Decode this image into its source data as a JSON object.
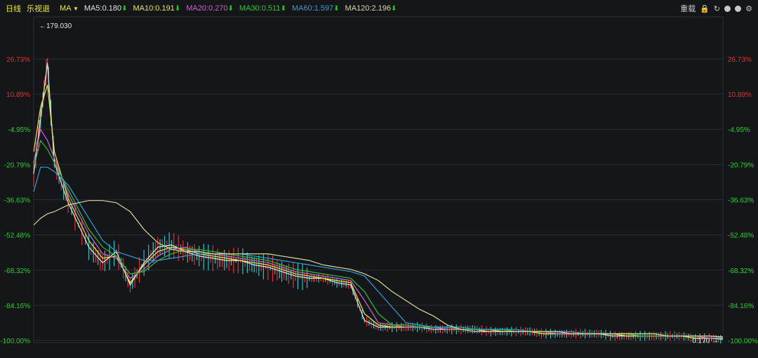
{
  "header": {
    "period": "日线",
    "stock_name": "乐视退",
    "indicator": "MA",
    "ma_items": [
      {
        "label": "MA5:0.180",
        "color": "#e6e6e6"
      },
      {
        "label": "MA10:0.191",
        "color": "#e8e840"
      },
      {
        "label": "MA20:0.270",
        "color": "#d060d0"
      },
      {
        "label": "MA30:0.511",
        "color": "#30c030"
      },
      {
        "label": "MA60:1.597",
        "color": "#2aa0d8"
      },
      {
        "label": "MA120:2.196",
        "color": "#d8d890"
      }
    ],
    "ma_arrow": "⬇",
    "tools_label": "重载"
  },
  "colors": {
    "background": "#15161a",
    "grid": "#2a2c31",
    "up": "#e03030",
    "down": "#30c0c0",
    "neg_label": "#22d022",
    "pos_label": "#e03030"
  },
  "chart_data": {
    "type": "line",
    "y_scale": "percent change",
    "ylim": [
      -100,
      40
    ],
    "yticks": [
      "26.73%",
      "10.89%",
      "-4.95%",
      "-20.79%",
      "-36.63%",
      "-52.48%",
      "-68.32%",
      "-84.16%",
      "-100.00%"
    ],
    "ytick_values": [
      26.73,
      10.89,
      -4.95,
      -20.79,
      -36.63,
      -52.48,
      -68.32,
      -84.16,
      -100.0
    ],
    "annotations": [
      {
        "text": "←179.030",
        "x": 0,
        "y": 36
      },
      {
        "text": "0.170 →",
        "x": 100,
        "y": -99.2
      }
    ],
    "x_domain": [
      0,
      100
    ],
    "series": [
      {
        "name": "MA5",
        "color": "#e6e6e6",
        "x": [
          0,
          1,
          2,
          3,
          5,
          8,
          10,
          12,
          14,
          16,
          18,
          20,
          22,
          24,
          26,
          28,
          30,
          32,
          34,
          36,
          38,
          40,
          42,
          44,
          46,
          48,
          50,
          52,
          54,
          56,
          58,
          60,
          62,
          64,
          66,
          68,
          70,
          72,
          74,
          76,
          78,
          80,
          82,
          84,
          86,
          88,
          90,
          92,
          94,
          96,
          98,
          100
        ],
        "y": [
          -25,
          0,
          25,
          -20,
          -38,
          -58,
          -65,
          -60,
          -75,
          -65,
          -58,
          -57,
          -60,
          -62,
          -63,
          -64,
          -64,
          -66,
          -67,
          -69,
          -71,
          -72,
          -72,
          -74,
          -75,
          -91,
          -94,
          -94,
          -94,
          -94,
          -95,
          -95,
          -95,
          -95,
          -96,
          -96,
          -96,
          -96,
          -97,
          -97,
          -97,
          -97,
          -97,
          -98,
          -98,
          -98,
          -98,
          -98,
          -98,
          -99,
          -99,
          -99.5
        ]
      },
      {
        "name": "MA10",
        "color": "#e8e840",
        "x": [
          0,
          1,
          2,
          3,
          5,
          8,
          10,
          12,
          14,
          16,
          18,
          20,
          22,
          24,
          26,
          28,
          30,
          32,
          34,
          36,
          38,
          40,
          42,
          44,
          46,
          48,
          50,
          52,
          54,
          56,
          58,
          60,
          62,
          64,
          66,
          68,
          70,
          72,
          74,
          76,
          78,
          80,
          82,
          84,
          86,
          88,
          90,
          92,
          94,
          96,
          98,
          100
        ],
        "y": [
          -15,
          5,
          15,
          -15,
          -36,
          -55,
          -63,
          -62,
          -74,
          -66,
          -60,
          -58,
          -59,
          -61,
          -62,
          -63,
          -64,
          -65,
          -66,
          -68,
          -70,
          -71,
          -72,
          -73,
          -74,
          -88,
          -93,
          -94,
          -94,
          -94,
          -94,
          -95,
          -95,
          -95,
          -95,
          -96,
          -96,
          -96,
          -97,
          -97,
          -97,
          -97,
          -97,
          -97,
          -98,
          -98,
          -98,
          -98,
          -98,
          -99,
          -99,
          -99.3
        ]
      },
      {
        "name": "MA20",
        "color": "#d060d0",
        "x": [
          0,
          1,
          2,
          3,
          5,
          8,
          10,
          12,
          14,
          16,
          18,
          20,
          22,
          24,
          26,
          28,
          30,
          32,
          34,
          36,
          38,
          40,
          42,
          44,
          46,
          48,
          50,
          52,
          54,
          56,
          58,
          60,
          62,
          64,
          66,
          68,
          70,
          72,
          74,
          76,
          78,
          80,
          82,
          84,
          86,
          88,
          90,
          92,
          94,
          96,
          98,
          100
        ],
        "y": [
          -20,
          -5,
          -10,
          -18,
          -34,
          -52,
          -61,
          -63,
          -72,
          -68,
          -62,
          -59,
          -58,
          -60,
          -61,
          -62,
          -63,
          -64,
          -65,
          -67,
          -69,
          -70,
          -71,
          -72,
          -73,
          -82,
          -92,
          -93,
          -94,
          -94,
          -94,
          -95,
          -95,
          -95,
          -95,
          -95,
          -96,
          -96,
          -96,
          -97,
          -97,
          -97,
          -97,
          -97,
          -97,
          -98,
          -98,
          -98,
          -98,
          -98,
          -99,
          -99.0
        ]
      },
      {
        "name": "MA30",
        "color": "#30c030",
        "x": [
          0,
          1,
          2,
          3,
          5,
          8,
          10,
          12,
          14,
          16,
          18,
          20,
          22,
          24,
          26,
          28,
          30,
          32,
          34,
          36,
          38,
          40,
          42,
          44,
          46,
          48,
          50,
          52,
          54,
          56,
          58,
          60,
          62,
          64,
          66,
          68,
          70,
          72,
          74,
          76,
          78,
          80,
          82,
          84,
          86,
          88,
          90,
          92,
          94,
          96,
          98,
          100
        ],
        "y": [
          -22,
          -10,
          -14,
          -20,
          -32,
          -50,
          -58,
          -62,
          -70,
          -69,
          -64,
          -61,
          -59,
          -59,
          -60,
          -61,
          -62,
          -63,
          -64,
          -66,
          -68,
          -69,
          -70,
          -71,
          -72,
          -78,
          -88,
          -93,
          -93,
          -94,
          -94,
          -94,
          -95,
          -95,
          -95,
          -95,
          -96,
          -96,
          -96,
          -96,
          -97,
          -97,
          -97,
          -97,
          -97,
          -98,
          -98,
          -98,
          -98,
          -98,
          -98,
          -98.8
        ]
      },
      {
        "name": "MA60",
        "color": "#2aa0d8",
        "x": [
          0,
          1,
          2,
          3,
          5,
          8,
          10,
          12,
          14,
          16,
          18,
          20,
          22,
          24,
          26,
          28,
          30,
          32,
          34,
          36,
          38,
          40,
          42,
          44,
          46,
          48,
          50,
          52,
          54,
          56,
          58,
          60,
          62,
          64,
          66,
          68,
          70,
          72,
          74,
          76,
          78,
          80,
          82,
          84,
          86,
          88,
          90,
          92,
          94,
          96,
          98,
          100
        ],
        "y": [
          -33,
          -22,
          -22,
          -24,
          -30,
          -45,
          -55,
          -60,
          -62,
          -64,
          -64,
          -63,
          -62,
          -61,
          -61,
          -61,
          -61,
          -62,
          -63,
          -64,
          -65,
          -66,
          -67,
          -68,
          -69,
          -71,
          -78,
          -85,
          -92,
          -93,
          -94,
          -94,
          -94,
          -95,
          -95,
          -95,
          -95,
          -96,
          -96,
          -96,
          -96,
          -97,
          -97,
          -97,
          -97,
          -97,
          -97,
          -98,
          -98,
          -98,
          -98,
          -98.6
        ]
      },
      {
        "name": "MA120",
        "color": "#d8d890",
        "x": [
          0,
          1,
          2,
          3,
          5,
          8,
          10,
          12,
          14,
          16,
          18,
          20,
          22,
          24,
          26,
          28,
          30,
          32,
          34,
          36,
          38,
          40,
          42,
          44,
          46,
          48,
          50,
          52,
          54,
          56,
          58,
          60,
          62,
          64,
          66,
          68,
          70,
          72,
          74,
          76,
          78,
          80,
          82,
          84,
          86,
          88,
          90,
          92,
          94,
          96,
          98,
          100
        ],
        "y": [
          -48,
          -45,
          -43,
          -42,
          -39,
          -37,
          -37,
          -38,
          -42,
          -50,
          -56,
          -59,
          -60,
          -60,
          -61,
          -61,
          -61,
          -61,
          -61,
          -62,
          -63,
          -64,
          -66,
          -67,
          -68,
          -70,
          -73,
          -78,
          -82,
          -86,
          -89,
          -93,
          -95,
          -96,
          -96,
          -96,
          -96,
          -96,
          -96,
          -96,
          -97,
          -97,
          -97,
          -97,
          -97,
          -97,
          -97,
          -98,
          -98,
          -98,
          -98,
          -98.4
        ]
      }
    ]
  }
}
